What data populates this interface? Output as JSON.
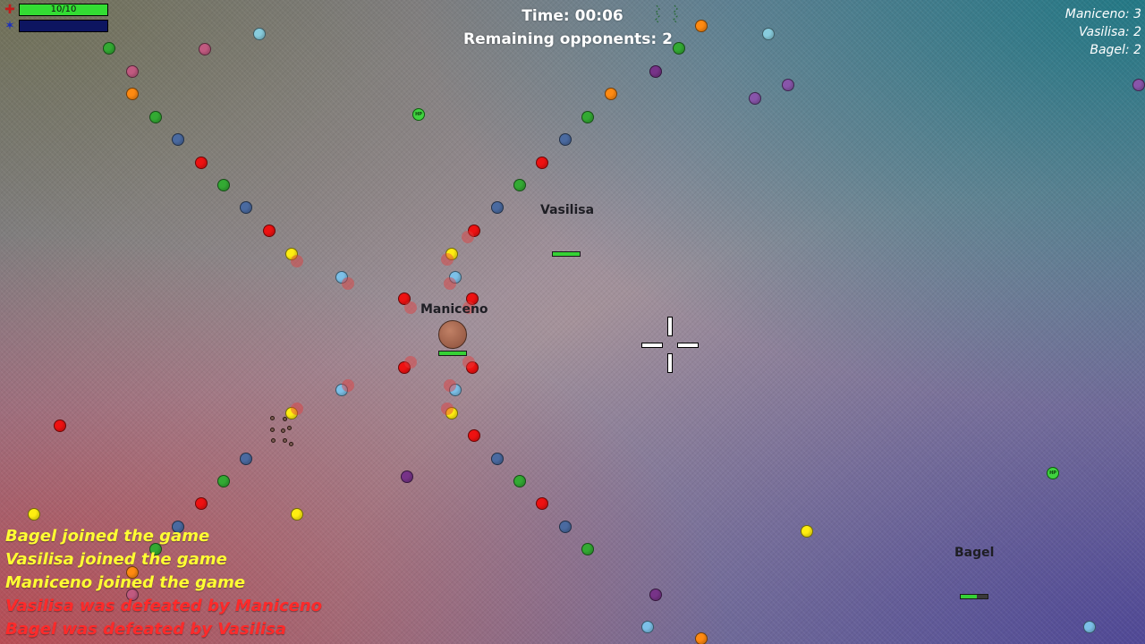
{
  "hud": {
    "health_text": "10/10",
    "health_fraction": 1.0,
    "mana_fraction": 0.0,
    "health_icon": "health-cross-icon",
    "mana_icon": "mana-star-icon",
    "health_color": "#33dd33",
    "mana_color": "#0d1560"
  },
  "timer": "Time: 00:06",
  "remaining": "Remaining opponents: 2",
  "scoreboard": [
    "Maniceno: 3",
    "Vasilisa: 2",
    "Bagel: 2"
  ],
  "players": [
    {
      "name": "Maniceno",
      "health_fraction": 1.0
    },
    {
      "name": "Vasilisa",
      "health_fraction": 1.0
    },
    {
      "name": "Bagel",
      "health_fraction": 0.6
    }
  ],
  "pickups": [
    "HP",
    "HP"
  ],
  "kill_feed": [
    {
      "text": "Bagel joined the game",
      "kind": "join"
    },
    {
      "text": "Vasilisa joined the game",
      "kind": "join"
    },
    {
      "text": "Maniceno joined the game",
      "kind": "join"
    },
    {
      "text": "Vasilisa was defeated by Maniceno",
      "kind": "defeat"
    },
    {
      "text": "Bagel was defeated by Vasilisa",
      "kind": "defeat"
    }
  ],
  "colors": {
    "red": "#ee1111",
    "green": "#33aa33",
    "orange": "#ff8a11",
    "yellow": "#ffee11",
    "steel": "#4a6aa0",
    "blue": "#3555a8",
    "lightblue": "#7cc0e8",
    "cyan": "#88ccdd",
    "pink": "#c05a80",
    "purple": "#773388",
    "violet": "#8855aa"
  }
}
